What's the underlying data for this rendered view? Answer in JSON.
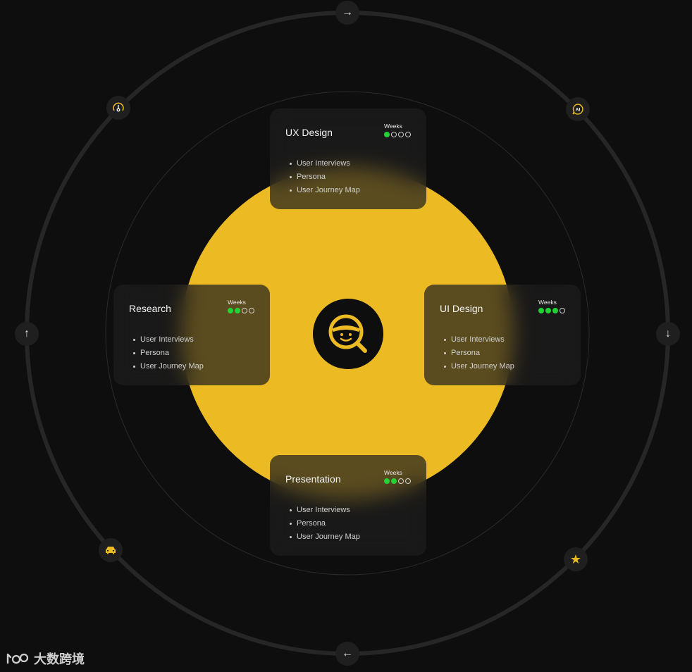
{
  "colors": {
    "background": "#0e0e0e",
    "accent": "#ecbb24",
    "ring": "#262626",
    "progress_on": "#22d336"
  },
  "center_icon": "steering-search-icon",
  "ring_nodes": [
    {
      "name": "arrow-right-icon",
      "glyph": "→"
    },
    {
      "name": "ai-chat-icon",
      "glyph": "AI"
    },
    {
      "name": "arrow-down-icon",
      "glyph": "↓"
    },
    {
      "name": "star-icon",
      "glyph": "★"
    },
    {
      "name": "arrow-left-icon",
      "glyph": "←"
    },
    {
      "name": "car-icon",
      "glyph": ""
    },
    {
      "name": "arrow-up-icon",
      "glyph": "↑"
    },
    {
      "name": "gauge-icon",
      "glyph": ""
    }
  ],
  "cards": {
    "ux": {
      "title": "UX Design",
      "weeks_label": "Weeks",
      "weeks_done": 1,
      "weeks_total": 4,
      "items": [
        "User Interviews",
        "Persona",
        "User Journey Map"
      ]
    },
    "research": {
      "title": "Research",
      "weeks_label": "Weeks",
      "weeks_done": 2,
      "weeks_total": 4,
      "items": [
        "User Interviews",
        "Persona",
        "User Journey Map"
      ]
    },
    "ui": {
      "title": "UI Design",
      "weeks_label": "Weeks",
      "weeks_done": 3,
      "weeks_total": 4,
      "items": [
        "User Interviews",
        "Persona",
        "User Journey Map"
      ]
    },
    "presentation": {
      "title": "Presentation",
      "weeks_label": "Weeks",
      "weeks_done": 2,
      "weeks_total": 4,
      "items": [
        "User Interviews",
        "Persona",
        "User Journey Map"
      ]
    }
  },
  "watermark": "大数跨境"
}
